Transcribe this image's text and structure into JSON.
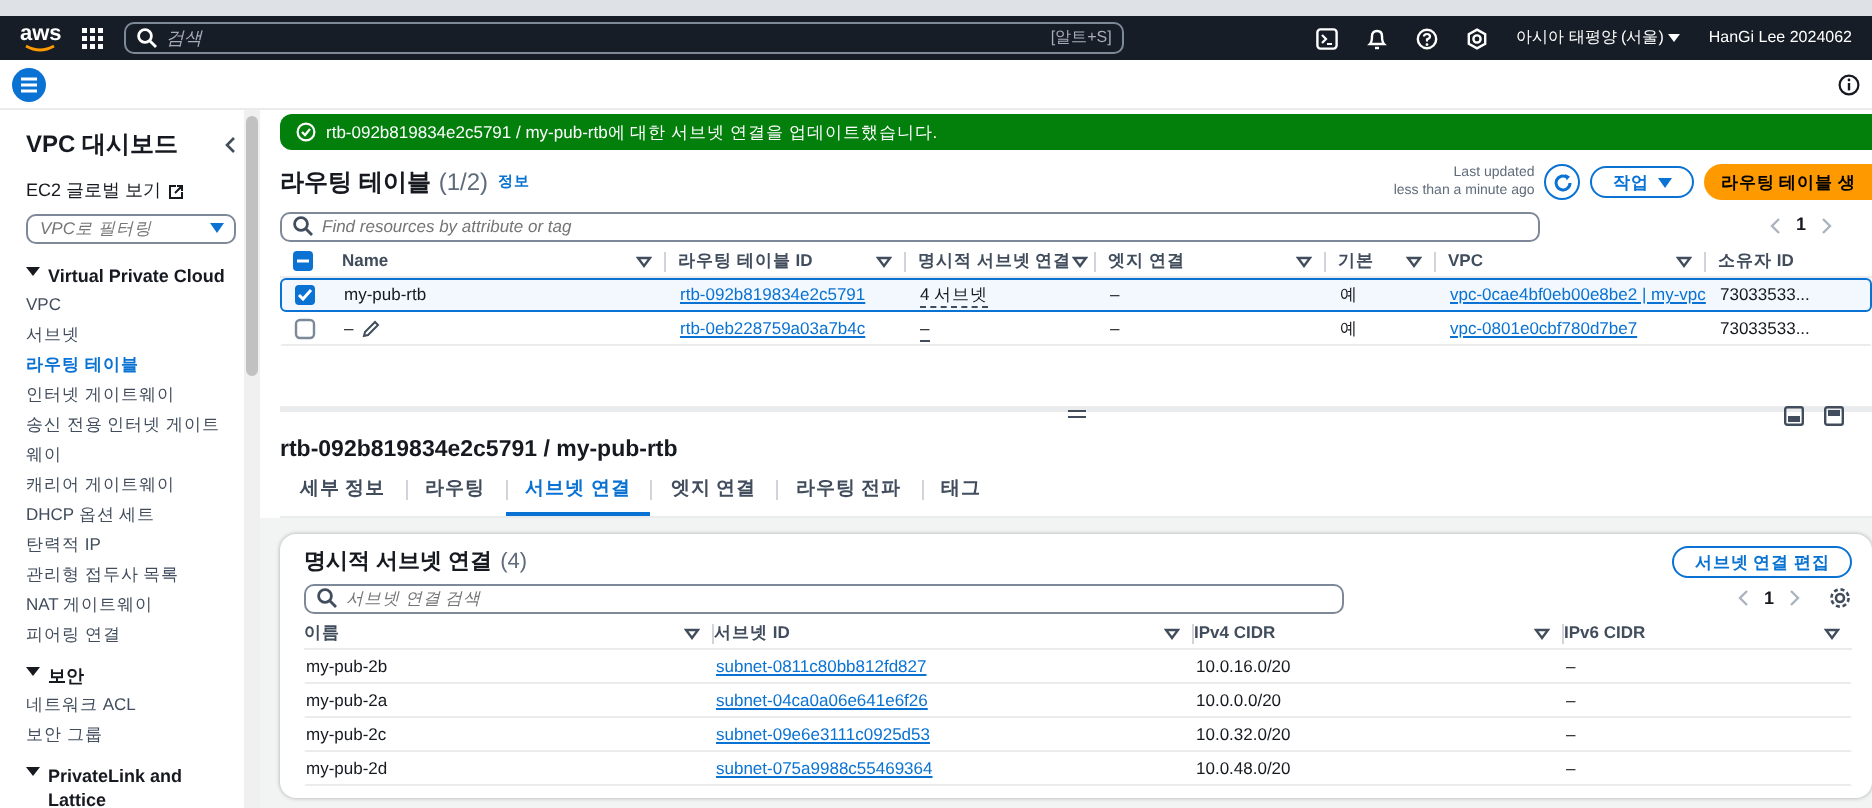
{
  "top_nav": {
    "logo": "aws",
    "search_placeholder": "검색",
    "search_shortcut": "[알트+S]",
    "region": "아시아 태평양 (서울)",
    "user": "HanGi Lee 2024062"
  },
  "sidebar": {
    "title": "VPC 대시보드",
    "global_view": "EC2 글로벌 보기",
    "filter_placeholder": "VPC로 필터링",
    "sections": [
      {
        "title": "Virtual Private Cloud",
        "expanded": true,
        "items": [
          {
            "label": "VPC",
            "selected": false
          },
          {
            "label": "서브넷",
            "selected": false
          },
          {
            "label": "라우팅 테이블",
            "selected": true
          },
          {
            "label": "인터넷 게이트웨이",
            "selected": false
          },
          {
            "label": "송신 전용 인터넷 게이트웨이",
            "selected": false
          },
          {
            "label": "캐리어 게이트웨이",
            "selected": false
          },
          {
            "label": "DHCP 옵션 세트",
            "selected": false
          },
          {
            "label": "탄력적 IP",
            "selected": false
          },
          {
            "label": "관리형 접두사 목록",
            "selected": false
          },
          {
            "label": "NAT 게이트웨이",
            "selected": false
          },
          {
            "label": "피어링 연결",
            "selected": false
          }
        ]
      },
      {
        "title": "보안",
        "expanded": true,
        "items": [
          {
            "label": "네트워크 ACL",
            "selected": false
          },
          {
            "label": "보안 그룹",
            "selected": false
          }
        ]
      },
      {
        "title": "PrivateLink and Lattice",
        "expanded": true
      }
    ]
  },
  "flash": {
    "message": "rtb-092b819834e2c5791 / my-pub-rtb에 대한 서브넷 연결을 업데이트했습니다."
  },
  "route_tables": {
    "title": "라우팅 테이블",
    "count": "(1/2)",
    "info": "정보",
    "last_updated": "Last updated",
    "last_updated_detail": "less than a minute ago",
    "actions_button": "작업",
    "create_button": "라우팅 테이블 생",
    "search_placeholder": "Find resources by attribute or tag",
    "page": "1",
    "header_checkbox": {
      "checked": true,
      "indeterminate": true
    },
    "columns": [
      {
        "label": "Name",
        "kind": "text"
      },
      {
        "label": "라우팅 테이블 ID",
        "kind": "link"
      },
      {
        "label": "명시적 서브넷 연결",
        "kind": "dotted"
      },
      {
        "label": "엣지 연결",
        "kind": "text"
      },
      {
        "label": "기본",
        "kind": "text"
      },
      {
        "label": "VPC",
        "kind": "link"
      },
      {
        "label": "소유자 ID",
        "kind": "text"
      }
    ],
    "rows": [
      {
        "selected": true,
        "editable": false,
        "cells": [
          "my-pub-rtb",
          "rtb-092b819834e2c5791",
          "4 서브넷",
          "–",
          "예",
          "vpc-0cae4bf0eb00e8be2 | my-vpc",
          "73033533..."
        ]
      },
      {
        "selected": false,
        "editable": true,
        "cells": [
          "–",
          "rtb-0eb228759a03a7b4c",
          "–",
          "–",
          "예",
          "vpc-0801e0cbf780d7be7",
          "73033533..."
        ]
      }
    ]
  },
  "details": {
    "title": "rtb-092b819834e2c5791 / my-pub-rtb",
    "tabs": [
      {
        "label": "세부 정보",
        "selected": false
      },
      {
        "label": "라우팅",
        "selected": false
      },
      {
        "label": "서브넷 연결",
        "selected": true
      },
      {
        "label": "엣지 연결",
        "selected": false
      },
      {
        "label": "라우팅 전파",
        "selected": false
      },
      {
        "label": "태그",
        "selected": false
      }
    ],
    "card": {
      "title": "명시적 서브넷 연결",
      "count": "(4)",
      "edit_button": "서브넷 연결 편집",
      "search_placeholder": "서브넷 연결 검색",
      "page": "1",
      "columns": [
        {
          "label": "이름",
          "kind": "text"
        },
        {
          "label": "서브넷 ID",
          "kind": "link"
        },
        {
          "label": "IPv4 CIDR",
          "kind": "text"
        },
        {
          "label": "IPv6 CIDR",
          "kind": "text"
        }
      ],
      "rows": [
        [
          "my-pub-2b",
          "subnet-0811c80bb812fd827",
          "10.0.16.0/20",
          "–"
        ],
        [
          "my-pub-2a",
          "subnet-04ca0a06e641e6f26",
          "10.0.0.0/20",
          "–"
        ],
        [
          "my-pub-2c",
          "subnet-09e6e3111c0925d53",
          "10.0.32.0/20",
          "–"
        ],
        [
          "my-pub-2d",
          "subnet-075a9988c55469364",
          "10.0.48.0/20",
          "–"
        ]
      ]
    }
  }
}
